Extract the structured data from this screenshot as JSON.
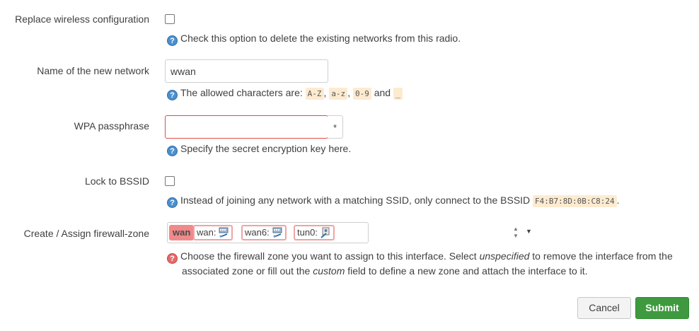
{
  "form": {
    "replace_wireless": {
      "label": "Replace wireless configuration",
      "checked": false,
      "hint": "Check this option to delete the existing networks from this radio."
    },
    "network_name": {
      "label": "Name of the new network",
      "value": "wwan",
      "hint_prefix": "The allowed characters are:",
      "codes": [
        "A-Z",
        "a-z",
        "0-9",
        "_"
      ],
      "sep": ",",
      "and": "and"
    },
    "wpa": {
      "label": "WPA passphrase",
      "value": "",
      "reveal": "*",
      "hint": "Specify the secret encryption key here."
    },
    "lock_bssid": {
      "label": "Lock to BSSID",
      "checked": false,
      "hint_prefix": "Instead of joining any network with a matching SSID, only connect to the BSSID",
      "bssid": "F4:B7:8D:0B:C8:24",
      "hint_suffix": "."
    },
    "firewall_zone": {
      "label": "Create / Assign firewall-zone",
      "selected": "wan",
      "chips": [
        {
          "label": "wan:",
          "icon": "network-interface-icon"
        },
        {
          "label": "wan6:",
          "icon": "network-interface-icon"
        },
        {
          "label": "tun0:",
          "icon": "tunnel-interface-icon"
        }
      ],
      "hint_line1_a": "Choose the firewall zone you want to assign to this interface. Select",
      "hint_em1": "unspecified",
      "hint_line1_b": "to remove the interface from the",
      "hint_line2_a": "associated zone or fill out the",
      "hint_em2": "custom",
      "hint_line2_b": "field to define a new zone and attach the interface to it."
    }
  },
  "hint_icon": "?",
  "buttons": {
    "cancel": "Cancel",
    "submit": "Submit"
  },
  "colors": {
    "submit": "#3f9a3f",
    "zone_wan": "#f08a8a",
    "error_border": "#e34b4b"
  }
}
